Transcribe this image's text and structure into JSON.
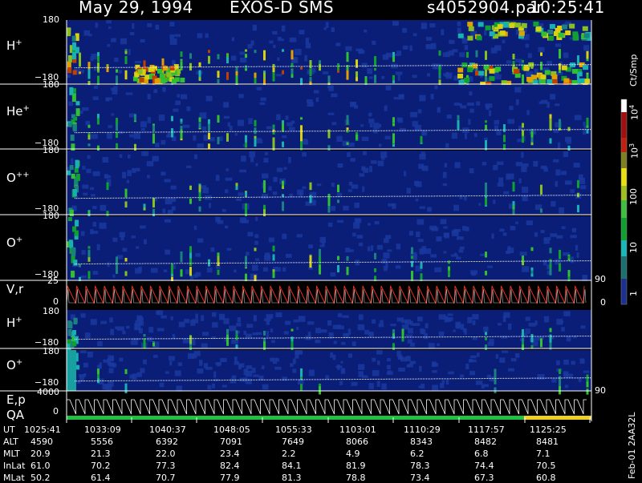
{
  "header": {
    "date": "May 29, 1994",
    "mission": "EXOS-D SMS",
    "file": "s4052904.par",
    "time": "10:25:41"
  },
  "panels": [
    {
      "label": "H",
      "charge": "+",
      "ytop": "180",
      "ybot": "−180"
    },
    {
      "label": "He",
      "charge": "+",
      "ytop": "180",
      "ybot": "−180"
    },
    {
      "label": "O",
      "charge": "++",
      "ytop": "180",
      "ybot": "−180"
    },
    {
      "label": "O",
      "charge": "+",
      "ytop": "180",
      "ybot": "−180"
    },
    {
      "label": "V,r",
      "charge": "",
      "ytop": "25",
      "ybot": "0",
      "right_top": "90",
      "right_bot": "0"
    },
    {
      "label": "H",
      "charge": "+",
      "ytop": "180",
      "ybot": "−180"
    },
    {
      "label": "O",
      "charge": "+",
      "ytop": "180",
      "ybot": "−180",
      "right_top": "90"
    },
    {
      "label": "E,p",
      "label2": "QA",
      "charge": "",
      "ytop": "4000",
      "ybot": "0"
    }
  ],
  "colorbar": {
    "unit": "Ct/Smp",
    "ticks": [
      {
        "base": "10",
        "exp": "4"
      },
      {
        "base": "10",
        "exp": "3"
      },
      {
        "base": "100",
        "exp": ""
      },
      {
        "base": "10",
        "exp": ""
      },
      {
        "base": "1",
        "exp": ""
      }
    ]
  },
  "table": {
    "rows": [
      {
        "name": "UT",
        "values": [
          "1025:41",
          "1033:09",
          "1040:37",
          "1048:05",
          "1055:33",
          "1103:01",
          "1110:29",
          "1117:57",
          "1125:25"
        ]
      },
      {
        "name": "ALT",
        "values": [
          "4590",
          "5556",
          "6392",
          "7091",
          "7649",
          "8066",
          "8343",
          "8482",
          "8481"
        ]
      },
      {
        "name": "MLT",
        "values": [
          "20.9",
          "21.3",
          "22.0",
          "23.4",
          "2.2",
          "4.9",
          "6.2",
          "6.8",
          "7.1"
        ]
      },
      {
        "name": "InLat",
        "values": [
          "61.0",
          "70.2",
          "77.3",
          "82.4",
          "84.1",
          "81.9",
          "78.3",
          "74.4",
          "70.5"
        ]
      },
      {
        "name": "MLat",
        "values": [
          "50.2",
          "61.4",
          "70.7",
          "77.9",
          "81.3",
          "78.8",
          "73.4",
          "67.3",
          "60.8"
        ]
      }
    ]
  },
  "footer": {
    "version": "Feb-01 2AA32L"
  },
  "colors": {
    "background": "#000000",
    "panel_fill": "#0a1e78",
    "trace": "#ffffff",
    "vr_trace": "#e03020",
    "qa_green": "#20c040",
    "qa_yellow": "#f0d020"
  },
  "chart_data": {
    "type": "heatmap",
    "title": "May 29, 1994   EXOS-D SMS",
    "x_tick_labels": [
      "1025:41",
      "1033:09",
      "1040:37",
      "1048:05",
      "1055:33",
      "1103:01",
      "1110:29",
      "1117:57",
      "1125:25"
    ],
    "colorbar_unit": "Ct/Smp",
    "colorbar_range": [
      1,
      10000
    ],
    "colorbar_scale": "log",
    "panels": [
      "H+",
      "He+",
      "O++",
      "O+",
      "V,r",
      "H+",
      "O+",
      "E,p QA"
    ]
  }
}
